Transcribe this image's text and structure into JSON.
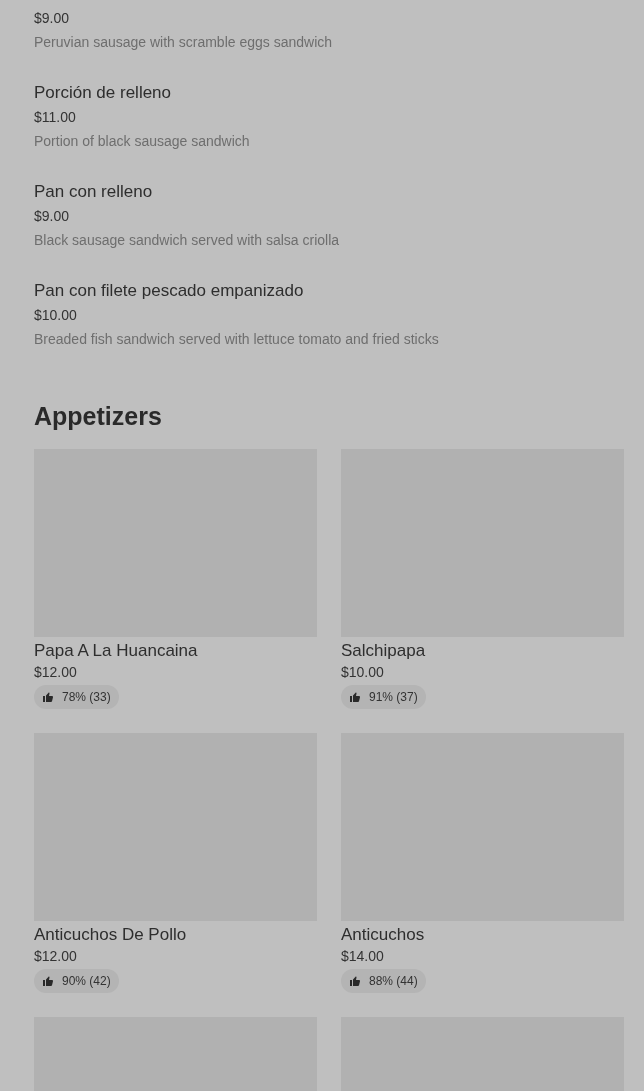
{
  "menu_items": [
    {
      "price": "$9.00",
      "description": "Peruvian sausage with scramble eggs sandwich"
    },
    {
      "name": "Porción de relleno",
      "price": "$11.00",
      "description": "Portion of black sausage sandwich"
    },
    {
      "name": "Pan con relleno",
      "price": "$9.00",
      "description": "Black sausage sandwich served with salsa criolla"
    },
    {
      "name": "Pan con filete pescado empanizado",
      "price": "$10.00",
      "description": "Breaded fish sandwich served with lettuce tomato and fried sticks"
    }
  ],
  "section": {
    "title": "Appetizers",
    "cards": [
      {
        "kind": "item",
        "name": "Papa A La Huancaina",
        "price": "$12.00",
        "rating": "78% (33)"
      },
      {
        "kind": "item",
        "name": "Salchipapa",
        "price": "$10.00",
        "rating": "91% (37)"
      },
      {
        "kind": "item",
        "name": "Anticuchos De Pollo",
        "price": "$12.00",
        "rating": "90% (42)"
      },
      {
        "kind": "item",
        "name": "Anticuchos",
        "price": "$14.00",
        "rating": "88% (44)"
      },
      {
        "kind": "image_only"
      },
      {
        "kind": "image_only"
      }
    ]
  }
}
